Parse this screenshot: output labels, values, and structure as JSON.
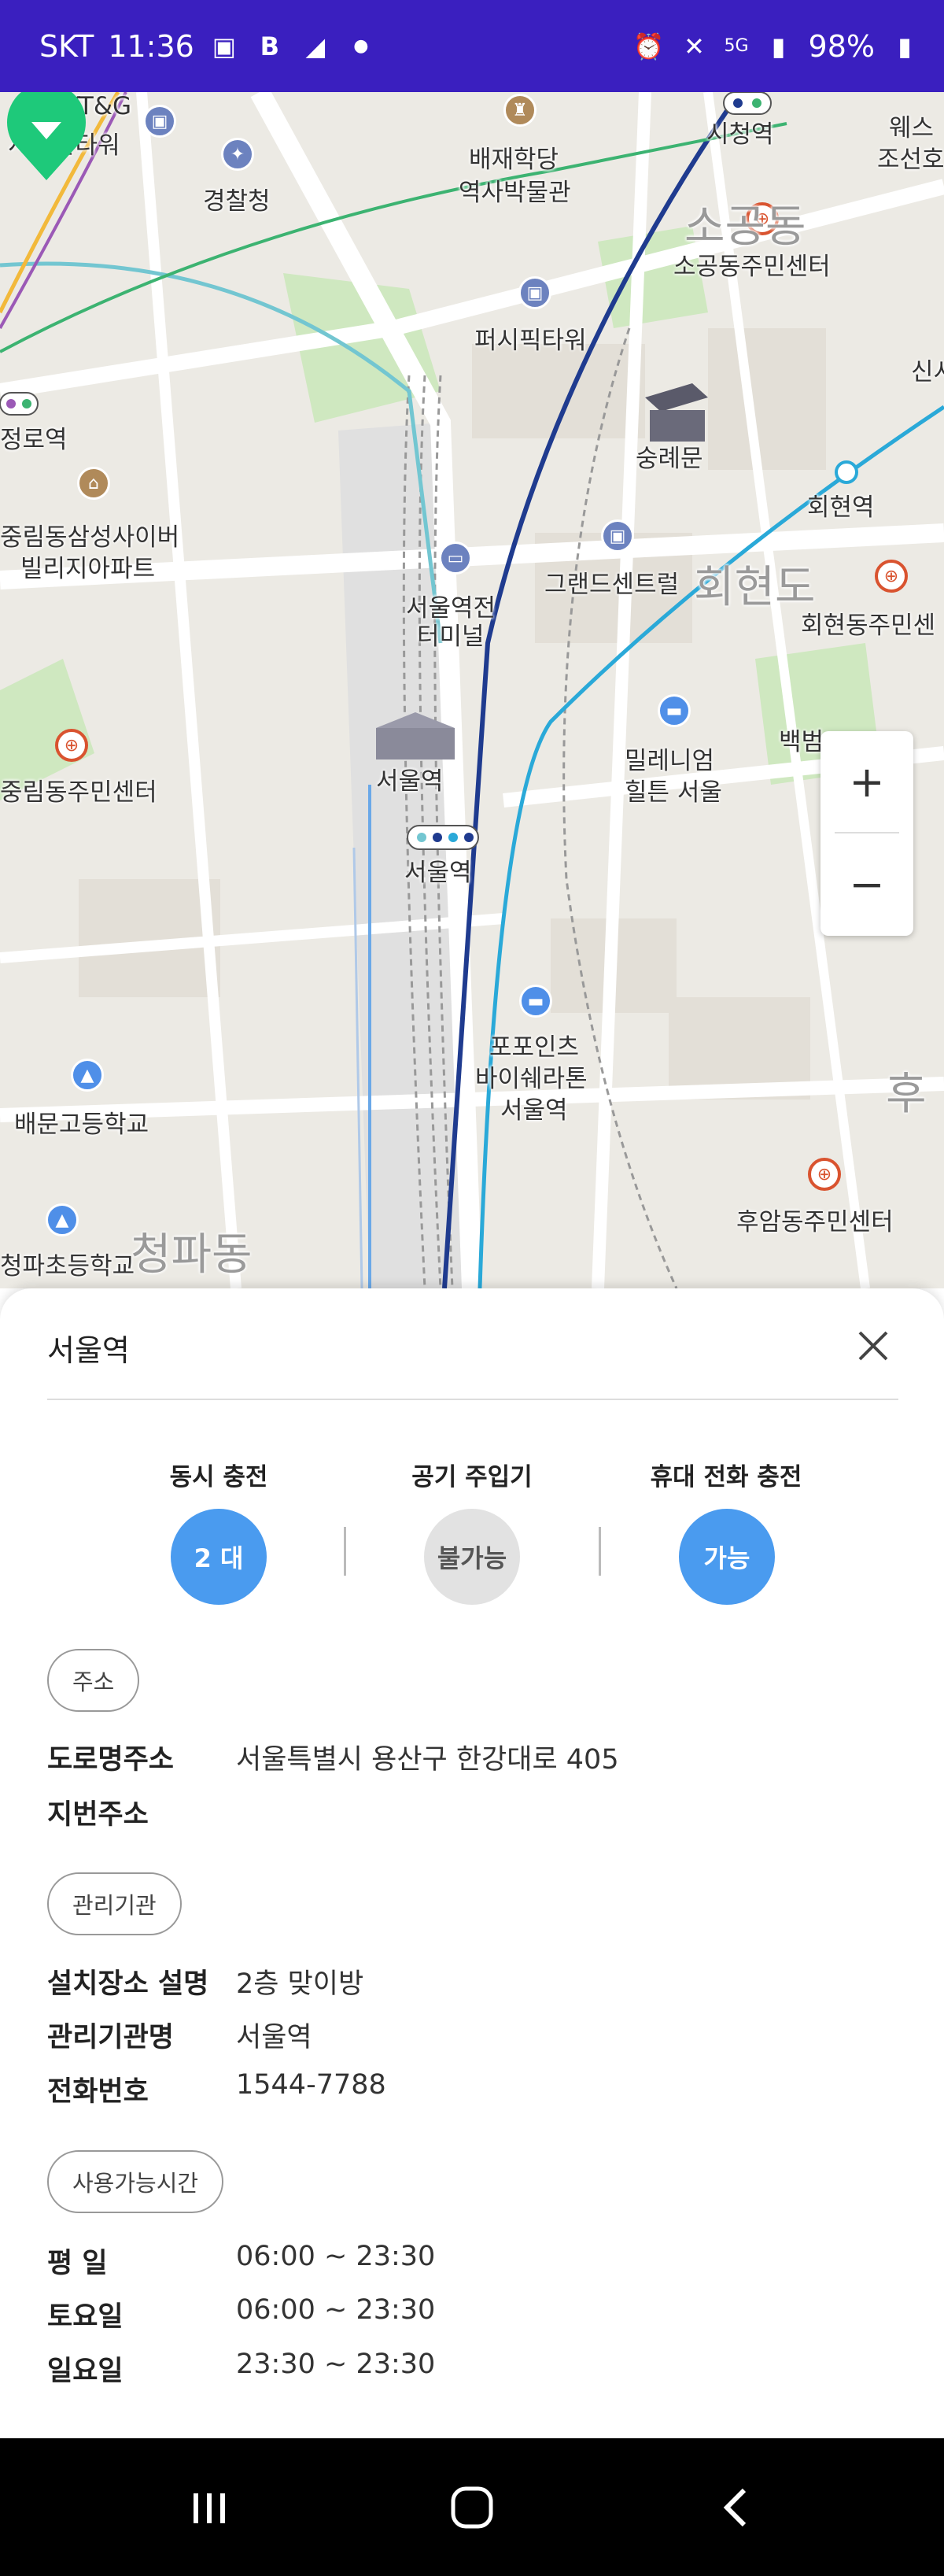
{
  "status_bar": {
    "carrier": "SKT",
    "time": "11:36",
    "battery": "98%",
    "network": "5G",
    "colors": {
      "background": "#3a1fbf"
    }
  },
  "map": {
    "labels": [
      {
        "text": "KT&G",
        "key": "ktg"
      },
      {
        "text": "서대문타워",
        "key": "seodaemun_tower"
      },
      {
        "text": "경찰청",
        "key": "police"
      },
      {
        "text": "배재학당",
        "key": "paichai1"
      },
      {
        "text": "역사박물관",
        "key": "paichai2"
      },
      {
        "text": "시청역",
        "key": "cityhall"
      },
      {
        "text": "웨스",
        "key": "west1"
      },
      {
        "text": "조선호",
        "key": "west2"
      },
      {
        "text": "소공동",
        "key": "sogong_big"
      },
      {
        "text": "소공동주민센터",
        "key": "sogong_center"
      },
      {
        "text": "퍼시픽타워",
        "key": "pacific"
      },
      {
        "text": "신시",
        "key": "sinse"
      },
      {
        "text": "정로역",
        "key": "jeongro"
      },
      {
        "text": "숭례문",
        "key": "sungnyemun"
      },
      {
        "text": "회현역",
        "key": "hoehyeon"
      },
      {
        "text": "중림동삼성사이버",
        "key": "jungnim1"
      },
      {
        "text": "빌리지아파트",
        "key": "jungnim2"
      },
      {
        "text": "서울역전",
        "key": "station_front1"
      },
      {
        "text": "터미널",
        "key": "station_front2"
      },
      {
        "text": "그랜드센트럴",
        "key": "grand_central"
      },
      {
        "text": "회현도",
        "key": "hoehyeon_big"
      },
      {
        "text": "회현동주민센",
        "key": "hoehyeon_center"
      },
      {
        "text": "밀레니엄",
        "key": "millennium1"
      },
      {
        "text": "힐튼 서울",
        "key": "millennium2"
      },
      {
        "text": "백범",
        "key": "baekbeom"
      },
      {
        "text": "서울역",
        "key": "seoul_station1"
      },
      {
        "text": "서울역",
        "key": "seoul_station2"
      },
      {
        "text": "중림동주민센터",
        "key": "jungnim_center"
      },
      {
        "text": "포포인츠",
        "key": "fourpoints1"
      },
      {
        "text": "바이쉐라톤",
        "key": "fourpoints2"
      },
      {
        "text": "서울역",
        "key": "fourpoints3"
      },
      {
        "text": "배문고등학교",
        "key": "baemun"
      },
      {
        "text": "후",
        "key": "hu_big"
      },
      {
        "text": "후암동주민센터",
        "key": "huam_center"
      },
      {
        "text": "청파초등학교",
        "key": "cheongpa_school"
      },
      {
        "text": "청파동",
        "key": "cheongpa_big"
      }
    ],
    "zoom_in": "+",
    "zoom_out": "−",
    "colors": {
      "marker": "#1ec97a",
      "land": "#eceae4",
      "park": "#cfe8c0",
      "road": "#ffffff",
      "line1": "#1f3b8f",
      "line4": "#2aa9d8",
      "airport": "#73c6d1"
    }
  },
  "sheet": {
    "title": "서울역",
    "features": [
      {
        "label": "동시 충전",
        "value": "2 대",
        "state": "on"
      },
      {
        "label": "공기 주입기",
        "value": "불가능",
        "state": "off"
      },
      {
        "label": "휴대 전화 충전",
        "value": "가능",
        "state": "on"
      }
    ],
    "sections": {
      "address": {
        "chip": "주소",
        "rows": [
          {
            "label": "도로명주소",
            "value": "서울특별시 용산구 한강대로 405"
          },
          {
            "label": "지번주소",
            "value": ""
          }
        ]
      },
      "agency": {
        "chip": "관리기관",
        "rows": [
          {
            "label": "설치장소 설명",
            "value": "2층 맞이방"
          },
          {
            "label": "관리기관명",
            "value": "서울역"
          },
          {
            "label": "전화번호",
            "value": "1544-7788"
          }
        ]
      },
      "hours": {
        "chip": "사용가능시간",
        "rows": [
          {
            "label": "평 일",
            "value": "06:00 ~ 23:30"
          },
          {
            "label": "토요일",
            "value": "06:00 ~ 23:30"
          },
          {
            "label": "일요일",
            "value": "23:30 ~ 23:30"
          }
        ]
      }
    },
    "colors": {
      "accent": "#4a9bef",
      "inactive": "#e2e2e2"
    }
  }
}
